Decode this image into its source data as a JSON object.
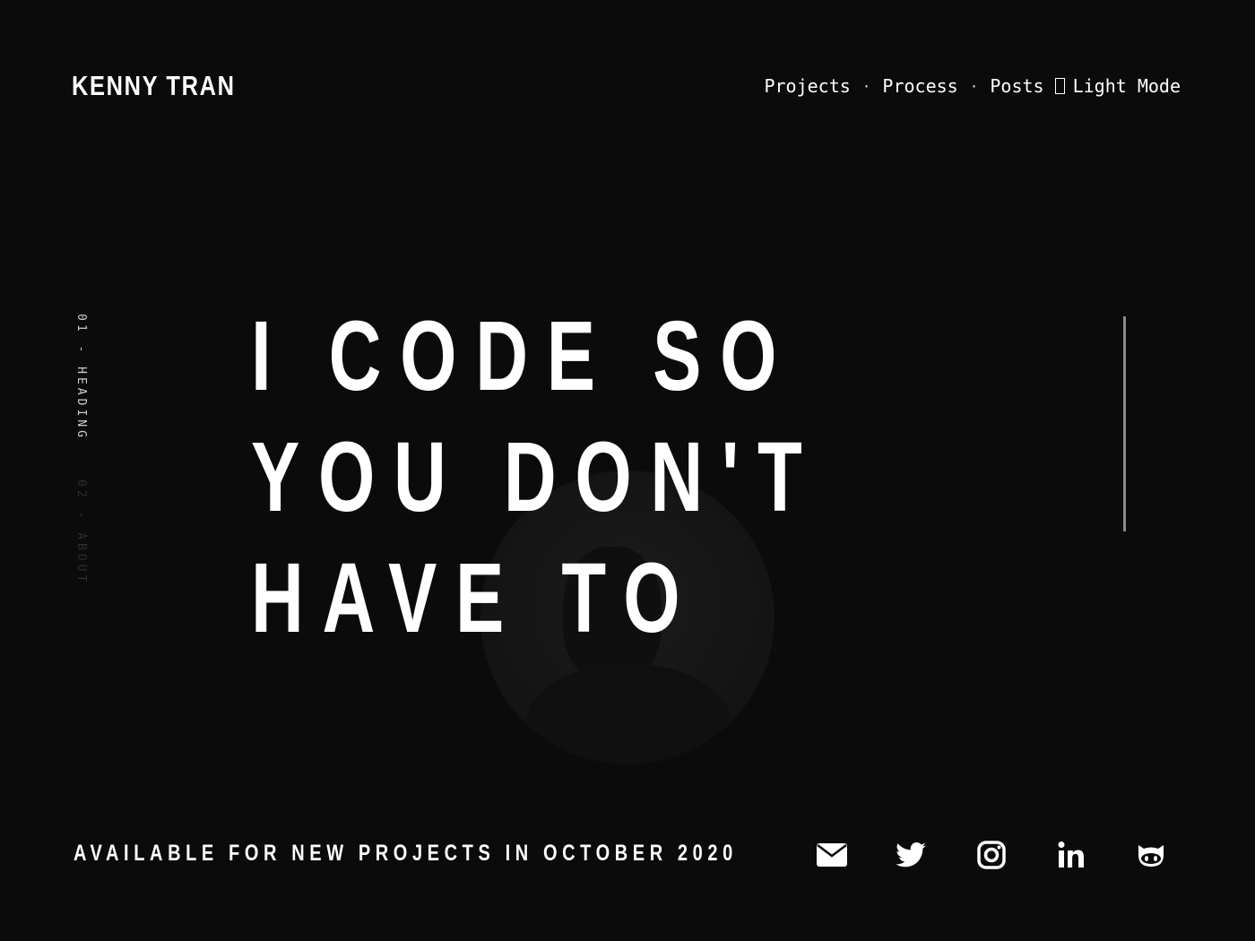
{
  "header": {
    "logo": "KENNY TRAN",
    "nav": {
      "projects": "Projects",
      "process": "Process",
      "posts": "Posts",
      "separator": "·",
      "theme_toggle": "Light Mode"
    }
  },
  "sections": {
    "active": "01 - HEADING",
    "next": "02 - ABOUT"
  },
  "hero": {
    "lines": [
      "I CODE SO",
      "YOU DON'T",
      "HAVE TO"
    ]
  },
  "footer": {
    "availability": "AVAILABLE FOR NEW PROJECTS IN OCTOBER 2020",
    "socials": [
      "mail-icon",
      "twitter-icon",
      "instagram-icon",
      "linkedin-icon",
      "github-icon"
    ]
  },
  "colors": {
    "background": "#0b0b0b",
    "text": "#ffffff",
    "scroll_line": "#8a8a8a"
  }
}
